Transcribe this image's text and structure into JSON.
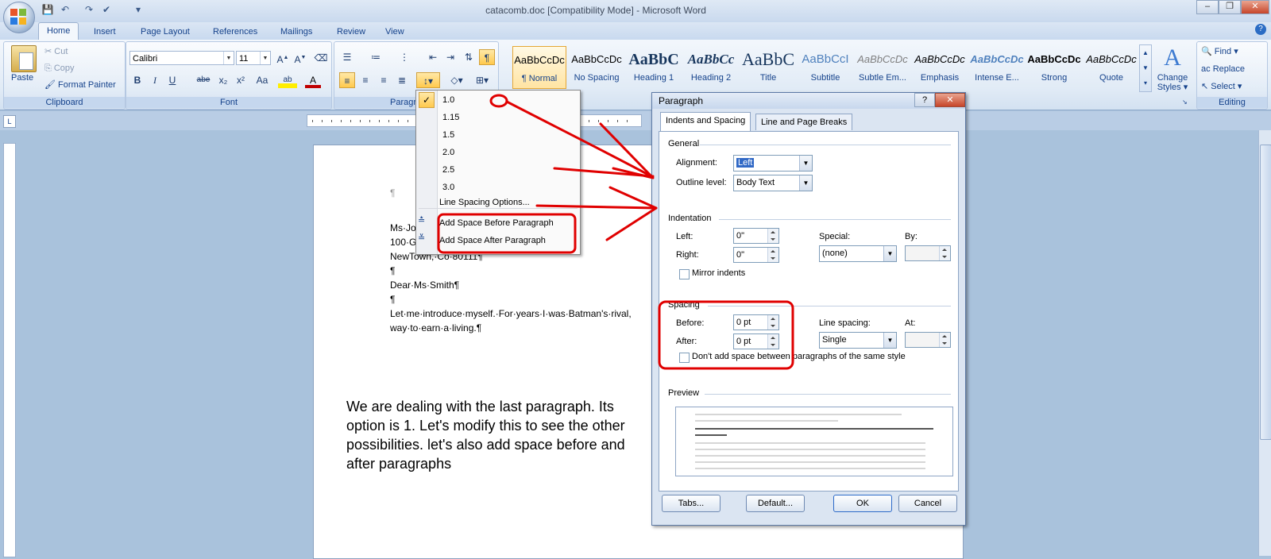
{
  "window": {
    "title": "catacomb.doc [Compatibility Mode] - Microsoft Word",
    "help": "?"
  },
  "tabs": [
    "Home",
    "Insert",
    "Page Layout",
    "References",
    "Mailings",
    "Review",
    "View"
  ],
  "clipboard": {
    "paste": "Paste",
    "cut": "Cut",
    "copy": "Copy",
    "format_painter": "Format Painter",
    "label": "Clipboard"
  },
  "font": {
    "name": "Calibri",
    "size": "11",
    "label": "Font",
    "bold": "B",
    "italic": "I",
    "underline": "U",
    "strike": "abe",
    "subscript": "x₂",
    "superscript": "x²",
    "case": "Aa",
    "highlight": "ab",
    "color": "A"
  },
  "paragraph": {
    "label": "Paragraph"
  },
  "styles": [
    {
      "preview": "AaBbCcDc",
      "name": "¶ Normal"
    },
    {
      "preview": "AaBbCcDc",
      "name": "No Spacing"
    },
    {
      "preview": "AaBbC",
      "name": "Heading 1"
    },
    {
      "preview": "AaBbCc",
      "name": "Heading 2"
    },
    {
      "preview": "AaBbC",
      "name": "Title"
    },
    {
      "preview": "AaBbCcI",
      "name": "Subtitle"
    },
    {
      "preview": "AaBbCcDc",
      "name": "Subtle Em..."
    },
    {
      "preview": "AaBbCcDc",
      "name": "Emphasis"
    },
    {
      "preview": "AaBbCcDc",
      "name": "Intense E..."
    },
    {
      "preview": "AaBbCcDc",
      "name": "Strong"
    },
    {
      "preview": "AaBbCcDc",
      "name": "Quote"
    }
  ],
  "change_styles": {
    "line1": "Change",
    "line2": "Styles"
  },
  "editing": {
    "find": "Find",
    "replace": "Replace",
    "select": "Select",
    "label": "Editing"
  },
  "line_spacing_menu": {
    "options": [
      "1.0",
      "1.15",
      "1.5",
      "2.0",
      "2.5",
      "3.0"
    ],
    "selected": "1.0",
    "more": "Line Spacing Options...",
    "add_before": "Add Space Before Paragraph",
    "add_after": "Add Space After Paragraph"
  },
  "document": {
    "lines": [
      "¶",
      "Ms·Jo",
      "100·G",
      "NewTown,·Co·80111¶",
      "¶",
      "Dear·Ms·Smith¶",
      "¶",
      "Let·me·introduce·myself.·For·years·I·was·Batman's·rival,",
      "way·to·earn·a·living.¶"
    ],
    "annotation": "We are dealing with the last paragraph. Its option is 1. Let's modify this to see the other possibilities. let's also add space before and after paragraphs"
  },
  "dialog": {
    "title": "Paragraph",
    "tabs": [
      "Indents and Spacing",
      "Line and Page Breaks"
    ],
    "general": {
      "heading": "General",
      "alignment_label": "Alignment:",
      "alignment": "Left",
      "outline_label": "Outline level:",
      "outline": "Body Text"
    },
    "indentation": {
      "heading": "Indentation",
      "left_label": "Left:",
      "left": "0\"",
      "right_label": "Right:",
      "right": "0\"",
      "special_label": "Special:",
      "special": "(none)",
      "by_label": "By:",
      "by": "",
      "mirror": "Mirror indents"
    },
    "spacing": {
      "heading": "Spacing",
      "before_label": "Before:",
      "before": "0 pt",
      "after_label": "After:",
      "after": "0 pt",
      "line_spacing_label": "Line spacing:",
      "line_spacing": "Single",
      "at_label": "At:",
      "at": "",
      "dont_add": "Don't add space between paragraphs of the same style"
    },
    "preview_heading": "Preview",
    "buttons": {
      "tabs": "Tabs...",
      "default": "Default...",
      "ok": "OK",
      "cancel": "Cancel"
    }
  }
}
